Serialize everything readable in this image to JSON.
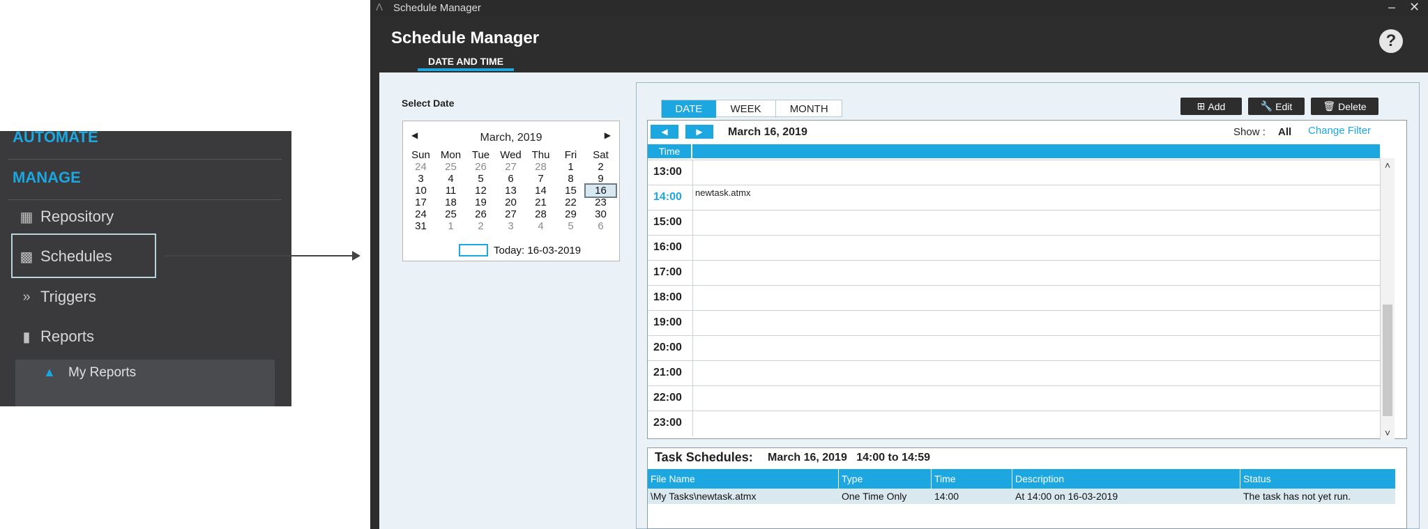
{
  "sidebar": {
    "heading_automate": "AUTOMATE",
    "heading_manage": "MANAGE",
    "items": [
      {
        "label": "Repository",
        "icon": "repository-icon"
      },
      {
        "label": "Schedules",
        "icon": "calendar-icon"
      },
      {
        "label": "Triggers",
        "icon": "double-chevron-icon"
      },
      {
        "label": "Reports",
        "icon": "bar-chart-icon"
      }
    ],
    "sub_item": {
      "label": "My Reports",
      "icon": "folder-open-icon"
    }
  },
  "window": {
    "titlebar": "Schedule Manager",
    "title": "Schedule Manager",
    "tab": "DATE AND TIME",
    "help": "?"
  },
  "select_date": {
    "label": "Select Date",
    "month": "March, 2019",
    "weekdays": [
      "Sun",
      "Mon",
      "Tue",
      "Wed",
      "Thu",
      "Fri",
      "Sat"
    ],
    "weeks": [
      [
        "24",
        "25",
        "26",
        "27",
        "28",
        "1",
        "2"
      ],
      [
        "3",
        "4",
        "5",
        "6",
        "7",
        "8",
        "9"
      ],
      [
        "10",
        "11",
        "12",
        "13",
        "14",
        "15",
        "16"
      ],
      [
        "17",
        "18",
        "19",
        "20",
        "21",
        "22",
        "23"
      ],
      [
        "24",
        "25",
        "26",
        "27",
        "28",
        "29",
        "30"
      ],
      [
        "31",
        "1",
        "2",
        "3",
        "4",
        "5",
        "6"
      ]
    ],
    "selected": "16",
    "today": "Today: 16-03-2019"
  },
  "view_tabs": [
    "DATE",
    "WEEK",
    "MONTH"
  ],
  "toolbar": {
    "add": "Add",
    "edit": "Edit",
    "delete": "Delete"
  },
  "day_view": {
    "date": "March 16, 2019",
    "show_label": "Show :",
    "show_value": "All",
    "change_filter": "Change Filter",
    "time_header": "Time",
    "hours": [
      "13:00",
      "14:00",
      "15:00",
      "16:00",
      "17:00",
      "18:00",
      "19:00",
      "20:00",
      "21:00",
      "22:00",
      "23:00"
    ],
    "task_hour": "14:00",
    "task_name": "newtask.atmx"
  },
  "task_schedules": {
    "title": "Task Schedules:",
    "subtitle": "March 16, 2019   14:00 to 14:59",
    "columns": [
      "File Name",
      "Type",
      "Time",
      "Description",
      "Status"
    ],
    "rows": [
      [
        "\\My Tasks\\newtask.atmx",
        "One Time Only",
        "14:00",
        "At 14:00 on 16-03-2019",
        "The task has not yet run."
      ]
    ]
  },
  "colors": {
    "accent": "#1ca7e0",
    "sidebar_bg": "#3a3a3c",
    "window_bg": "#2d2d2d"
  }
}
